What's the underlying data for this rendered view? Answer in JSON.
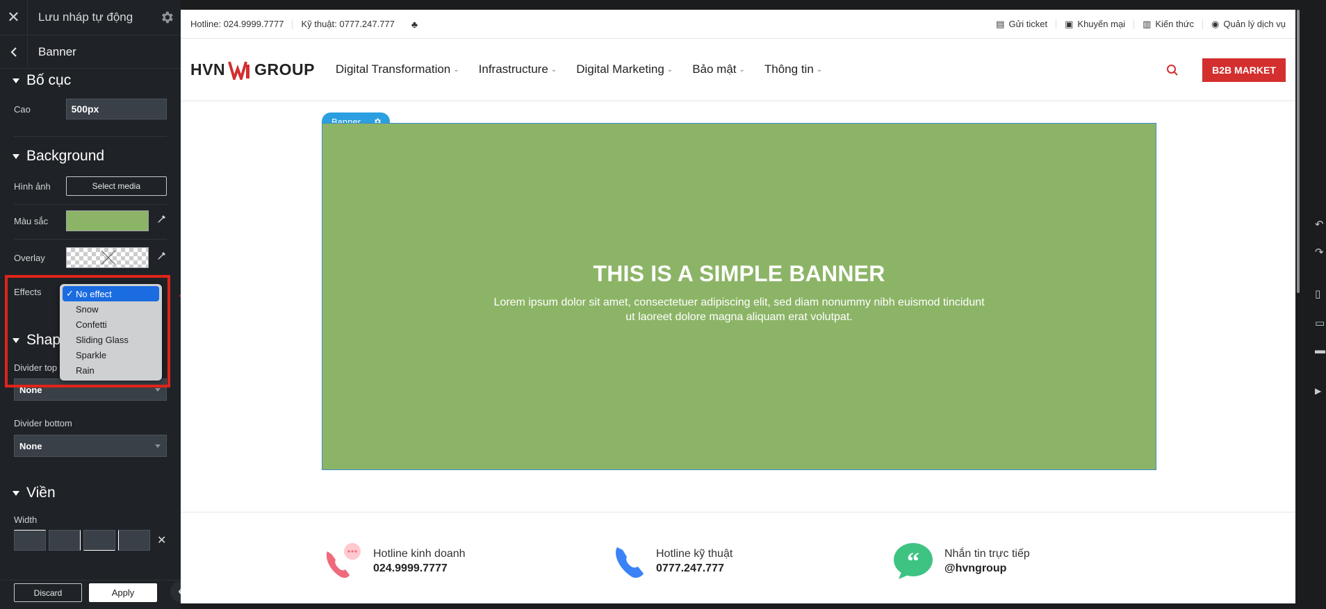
{
  "sidebar": {
    "title": "Lưu nháp tự động",
    "panel_title": "Banner",
    "layout": {
      "heading": "Bố cục",
      "height_label": "Cao",
      "height_value": "500px"
    },
    "background": {
      "heading": "Background",
      "image_label": "Hình ảnh",
      "select_media": "Select media",
      "color_label": "Màu sắc",
      "color_value": "#8cb466",
      "overlay_label": "Overlay",
      "effects_label": "Effects"
    },
    "effects_options": [
      "No effect",
      "Snow",
      "Confetti",
      "Sliding Glass",
      "Sparkle",
      "Rain"
    ],
    "effects_selected": "No effect",
    "shape": {
      "heading": "Shape",
      "divider_top_label": "Divider top",
      "divider_top_value": "None",
      "divider_bottom_label": "Divider bottom",
      "divider_bottom_value": "None"
    },
    "border": {
      "heading": "Viền",
      "width_label": "Width"
    },
    "discard_label": "Discard",
    "apply_label": "Apply"
  },
  "page": {
    "topbar": {
      "hotline": "Hotline: 024.9999.7777",
      "tech": "Kỹ thuật: 0777.247.777",
      "links": [
        "Gửi ticket",
        "Khuyến mại",
        "Kiến thức",
        "Quản lý dịch vụ"
      ]
    },
    "logo_left": "HVN",
    "logo_right": "GROUP",
    "nav": [
      "Digital Transformation",
      "Infrastructure",
      "Digital Marketing",
      "Bảo mật",
      "Thông tin"
    ],
    "b2b_label": "B2B MARKET",
    "banner_tag": "Banner",
    "banner_heading": "THIS IS A SIMPLE BANNER",
    "banner_text": "Lorem ipsum dolor sit amet, consectetuer adipiscing elit, sed diam nonummy nibh euismod tincidunt ut laoreet dolore magna aliquam erat volutpat.",
    "contacts": [
      {
        "label": "Hotline kinh doanh",
        "value": "024.9999.7777"
      },
      {
        "label": "Hotline kỹ thuật",
        "value": "0777.247.777"
      },
      {
        "label": "Nhắn tin trực tiếp",
        "value": "@hvngroup"
      }
    ]
  },
  "colors": {
    "accent": "#d32f2f",
    "banner": "#8cb466",
    "selection": "#1b6ce0",
    "highlight": "#e0241a"
  }
}
